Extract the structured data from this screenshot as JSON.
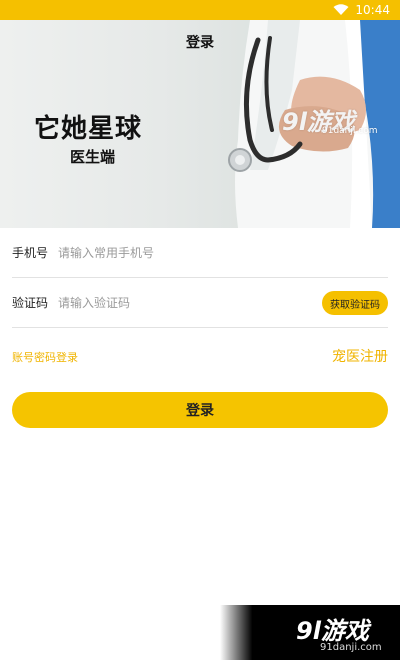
{
  "status_bar": {
    "time": "10:44",
    "icon": "wifi-icon"
  },
  "header": {
    "title": "登录"
  },
  "hero": {
    "brand_title": "它她星球",
    "brand_subtitle": "医生端",
    "watermark_main": "9l游戏",
    "watermark_url": "91danji.com"
  },
  "form": {
    "phone": {
      "label": "手机号",
      "placeholder": "请输入常用手机号",
      "value": ""
    },
    "code": {
      "label": "验证码",
      "placeholder": "请输入验证码",
      "value": "",
      "button_label": "获取验证码"
    }
  },
  "links": {
    "account_login": "账号密码登录",
    "register": "宠医注册"
  },
  "login_button": {
    "label": "登录"
  },
  "footer_watermark": {
    "main": "9l游戏",
    "url": "91danji.com"
  },
  "colors": {
    "accent": "#f5c000",
    "link": "#f0b400"
  }
}
